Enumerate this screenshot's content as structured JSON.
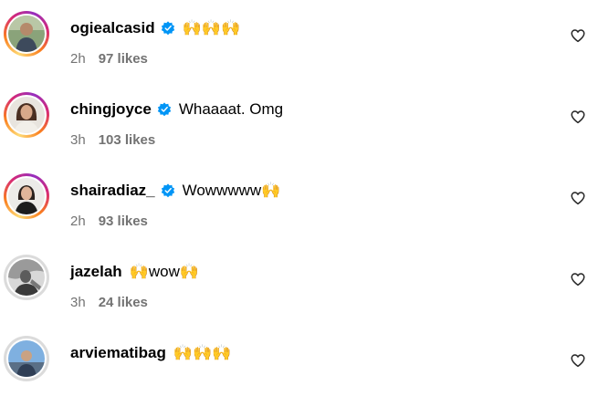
{
  "comments": [
    {
      "username": "ogiealcasid",
      "text": "🙌🙌🙌",
      "time": "2h",
      "likes": "97 likes",
      "verified": true
    },
    {
      "username": "chingjoyce",
      "text": "Whaaaat. Omg",
      "time": "3h",
      "likes": "103 likes",
      "verified": true
    },
    {
      "username": "shairadiaz_",
      "text": "Wowwwww🙌",
      "time": "2h",
      "likes": "93 likes",
      "verified": true
    },
    {
      "username": "jazelah",
      "text": "🙌wow🙌",
      "time": "3h",
      "likes": "24 likes",
      "verified": false
    },
    {
      "username": "arviematibag",
      "text": "🙌🙌🙌",
      "time": "",
      "likes": "",
      "verified": false
    }
  ],
  "icons": {
    "verified": "verified-badge-icon",
    "like": "heart-outline-icon"
  },
  "colors": {
    "verified": "#0095f6",
    "meta": "#737373"
  }
}
